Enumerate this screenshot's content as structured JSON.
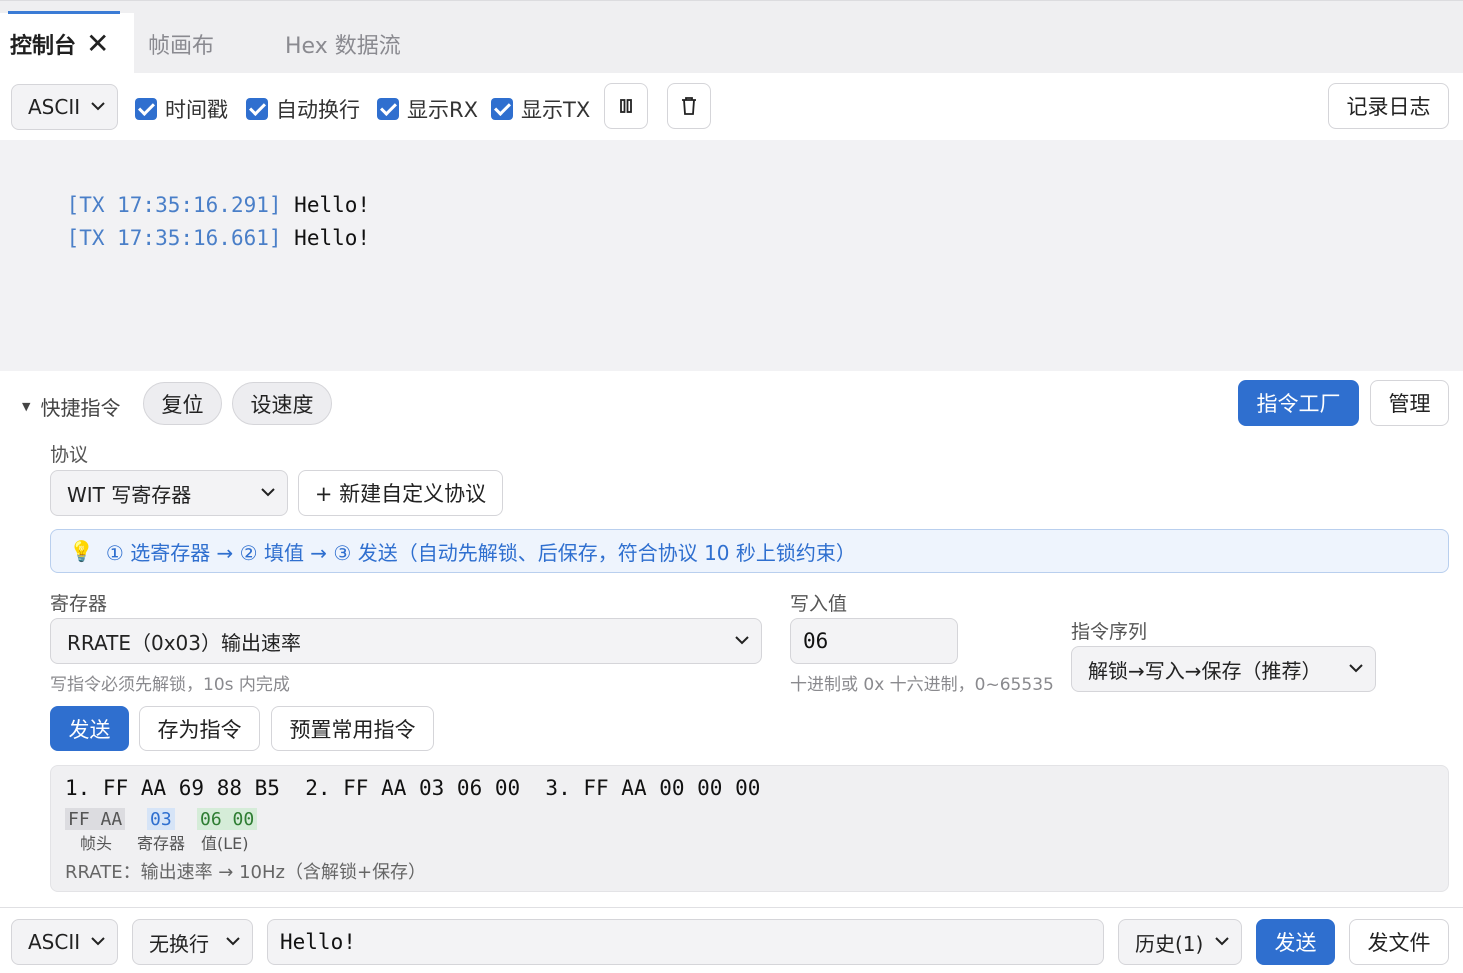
{
  "tabs": [
    {
      "label": "控制台",
      "active": true
    },
    {
      "label": "帧画布",
      "active": false
    },
    {
      "label": "Hex 数据流",
      "active": false
    }
  ],
  "toolbar": {
    "encoding": "ASCII",
    "checkboxes": [
      {
        "label": "时间戳",
        "checked": true
      },
      {
        "label": "自动换行",
        "checked": true
      },
      {
        "label": "显示RX",
        "checked": true
      },
      {
        "label": "显示TX",
        "checked": true
      }
    ],
    "record_label": "记录日志"
  },
  "console": {
    "lines": [
      {
        "prefix": "[TX 17:35:16.291]",
        "text": "Hello!"
      },
      {
        "prefix": "[TX 17:35:16.661]",
        "text": "Hello!"
      }
    ]
  },
  "quick": {
    "toggle_label": "快捷指令",
    "pills": [
      "复位",
      "设速度"
    ],
    "factory_label": "指令工厂",
    "manage_label": "管理"
  },
  "protocol": {
    "label": "协议",
    "selected": "WIT 写寄存器",
    "new_label": "+ 新建自定义协议"
  },
  "tip": "① 选寄存器 → ② 填值 → ③ 发送（自动先解锁、后保存，符合协议 10 秒上锁约束）",
  "register": {
    "label": "寄存器",
    "selected": "RRATE（0x03）输出速率",
    "hint": "写指令必须先解锁，10s 内完成"
  },
  "value": {
    "label": "写入值",
    "current": "06",
    "hint": "十进制或 0x 十六进制，0~65535"
  },
  "sequence": {
    "label": "指令序列",
    "selected": "解锁→写入→保存（推荐）"
  },
  "actions": {
    "send": "发送",
    "save_as": "存为指令",
    "preset": "预置常用指令"
  },
  "preview": {
    "seq": "1. FF AA 69 88 B5  2. FF AA 03 06 00  3. FF AA 00 00 00",
    "chips": [
      {
        "bytes": "FF AA",
        "label": "帧头",
        "color": "#dcdce0",
        "text_color": "#555555"
      },
      {
        "bytes": "03",
        "label": "寄存器",
        "color": "#d6e4f7",
        "text_color": "#2f6fcf"
      },
      {
        "bytes": "06 00",
        "label": "值(LE)",
        "color": "#d5ecd8",
        "text_color": "#2e7d32"
      }
    ],
    "summary": "RRATE：输出速率 → 10Hz（含解锁+保存）"
  },
  "bottom": {
    "encoding": "ASCII",
    "line_ending": "无换行",
    "input": "Hello!",
    "history": "历史(1)",
    "send": "发送",
    "send_file": "发文件"
  },
  "colors": {
    "accent": "#2f6fcf",
    "tx_prefix": "#4a7fc8"
  }
}
